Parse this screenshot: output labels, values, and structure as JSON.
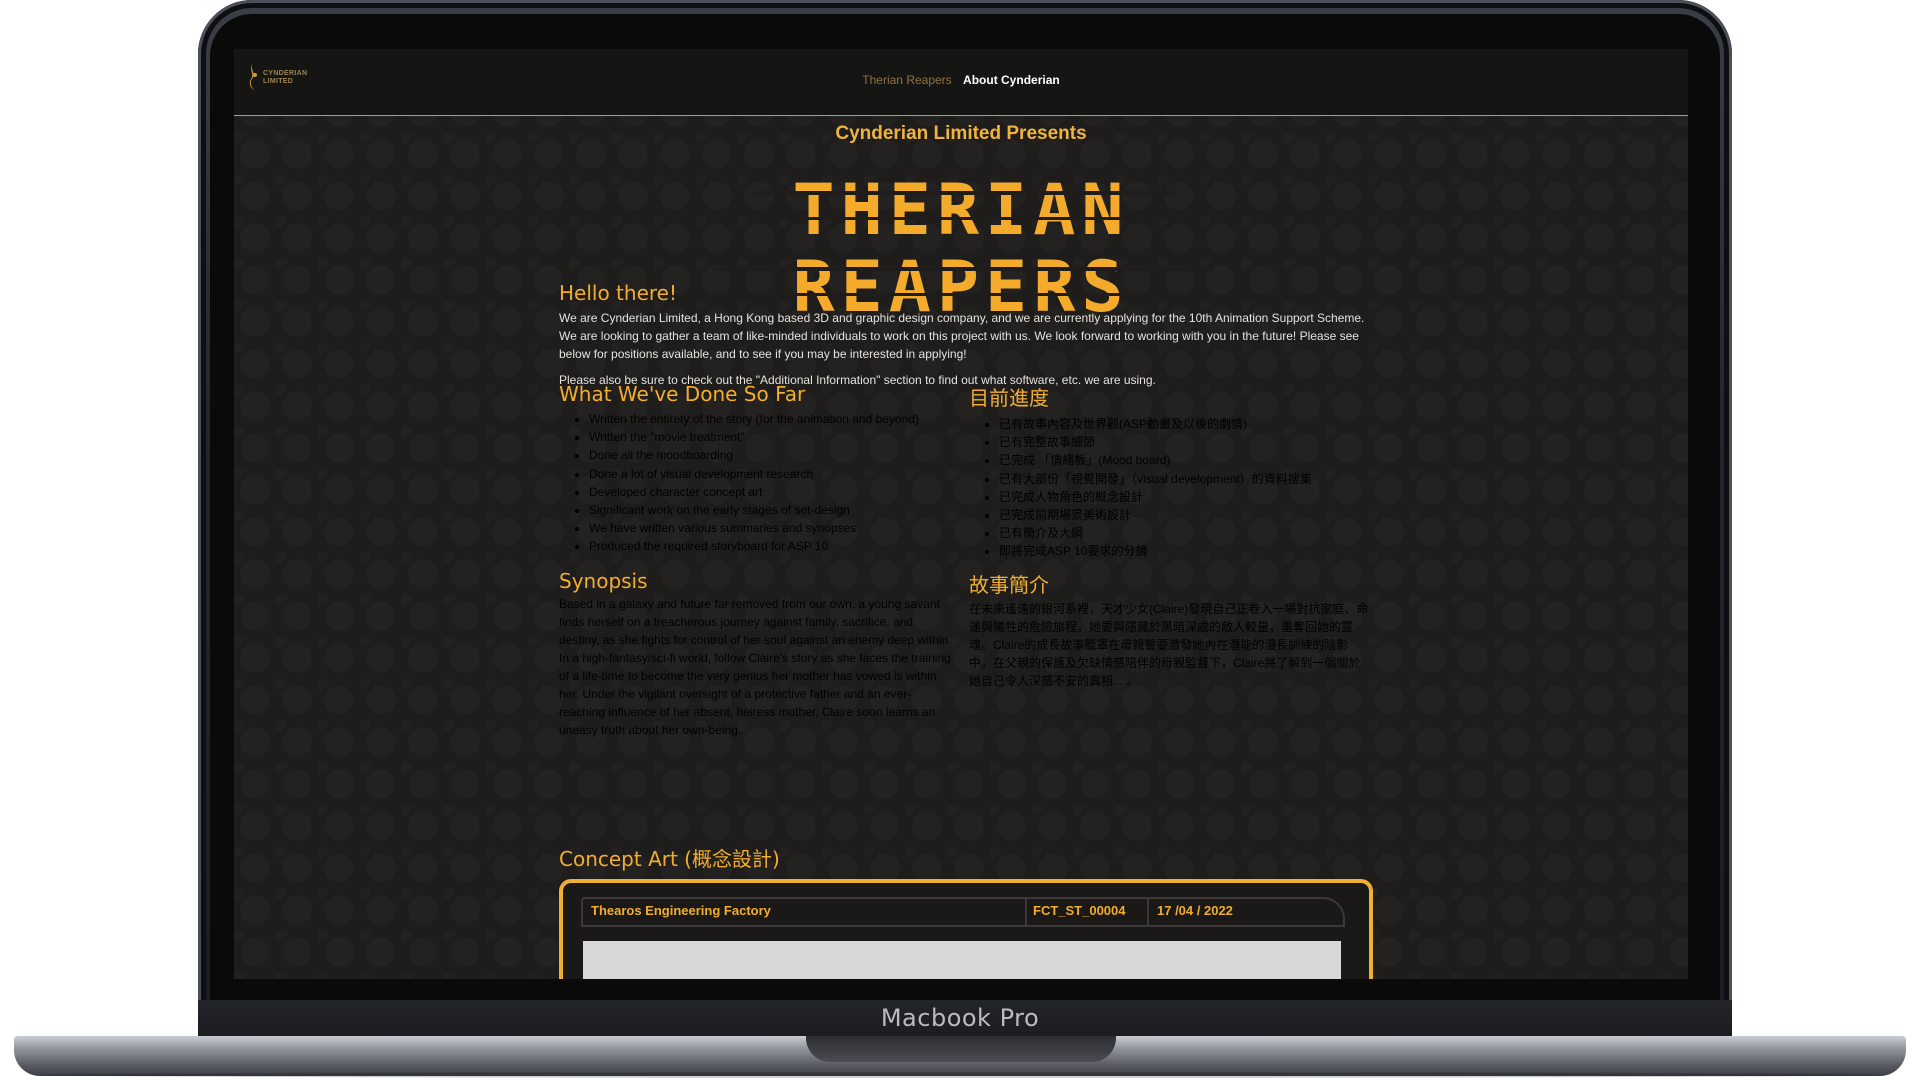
{
  "device": {
    "model_label": "Macbook Pro"
  },
  "nav": {
    "logo_text_line1": "CYNDERIAN",
    "logo_text_line2": "LIMITED",
    "links": [
      {
        "label": "Therian Reapers",
        "state": "inactive"
      },
      {
        "label": "About Cynderian",
        "state": "active"
      }
    ]
  },
  "hero": {
    "presents": "Cynderian Limited Presents",
    "title_line1": "THERIAN",
    "title_line2": "REAPERS"
  },
  "intro": {
    "heading": "Hello there!",
    "para1": "We are Cynderian Limited, a Hong Kong based 3D and graphic design company, and we are currently applying for the 10th Animation Support Scheme. We are looking to gather a team of like-minded individuals to work on this project with us. We look forward to working with you in the future! Please see below for positions available, and to see if you may be interested in applying!",
    "para2": "Please also be sure to check out the \"Additional Information\" section to find out what software, etc. we are using."
  },
  "progress_en": {
    "heading": "What We've Done So Far",
    "items": [
      "Written the entirety of the story (for the animation and beyond)",
      "Written the \"movie treatment\"",
      "Done all the moodboarding",
      "Done a lot of visual development research",
      "Developed character concept art",
      "Significant work on the early stages of set-design",
      "We have written various summaries and synopses",
      "Produced the required storyboard for ASP 10"
    ]
  },
  "progress_zh": {
    "heading": "目前進度",
    "items": [
      "已有故事內容及世界觀(ASP動畫及以後的劇情)",
      "已有完整故事細節",
      "已完成 「情緒板」(Mood board)",
      "已有大部份「視覺開發」（visual development）的資料搜集",
      "已完成人物角色的概念設計",
      "已完成前期場景美術設計",
      "已有簡介及大綱",
      "即將完成ASP 10要求的分鏡"
    ]
  },
  "synopsis_en": {
    "heading": "Synopsis",
    "text": "Based in a galaxy and future far removed from our own, a young savant finds herself on a treacherous journey against family, sacrifice, and destiny, as she fights for control of her soul against an enemy deep within. In a high-fantasy/sci-fi world, follow Claire's story as she faces the training of a life-time to become the very genius her mother has vowed is within her. Under the vigilant oversight of a protective father and an ever-reaching influence of her absent, heiress mother, Claire soon learns an uneasy truth about her own-being."
  },
  "synopsis_zh": {
    "heading": "故事簡介",
    "text": "在未來遙遠的銀河系裡，天才少女(Claire)發現自己正卷入一場對抗家庭、命運與犧牲的危險旅程。她要與隱藏於黑暗深處的敵人較量，重奪回她的靈魂。Claire的成長故事籠罩在母親誓要激發她內在潛能的漫長訓練的陰影中。在父親的保護及欠缺情感陪伴的母親監督下，Claire將了解到一個關於她自己令人深感不安的真相....。"
  },
  "concept_art": {
    "heading": "Concept Art (概念設計)",
    "card": {
      "name": "Thearos Engineering Factory",
      "code": "FCT_ST_00004",
      "date": "17 /04 / 2022"
    }
  },
  "colors": {
    "accent": "#f2ad2e",
    "background": "#1e1d1c",
    "nav_border": "#c39a46",
    "text": "#e6e3de"
  }
}
